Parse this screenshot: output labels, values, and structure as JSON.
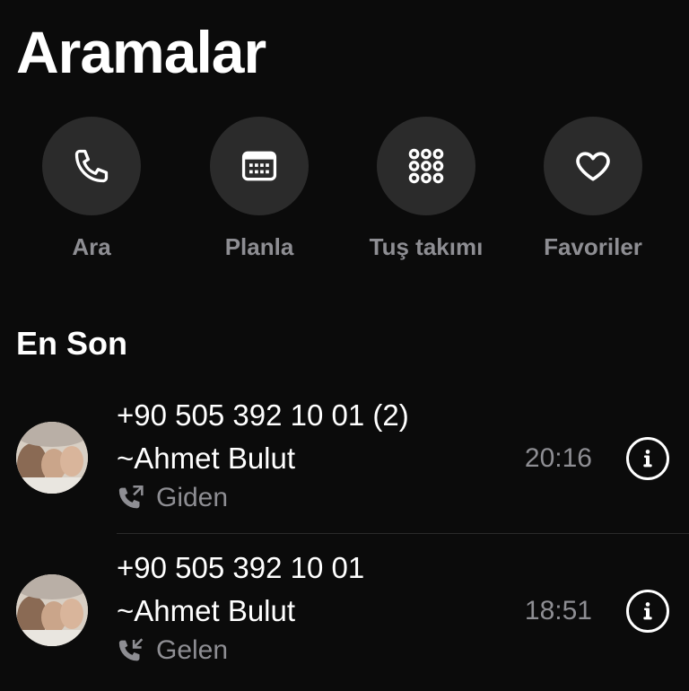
{
  "header": {
    "title": "Aramalar"
  },
  "actions": [
    {
      "label": "Ara",
      "icon": "phone-icon"
    },
    {
      "label": "Planla",
      "icon": "calendar-icon"
    },
    {
      "label": "Tuş takımı",
      "icon": "keypad-icon"
    },
    {
      "label": "Favoriler",
      "icon": "heart-icon"
    }
  ],
  "recents": {
    "title": "En Son",
    "items": [
      {
        "number": "+90 505 392 10 01  (2)",
        "name": "~Ahmet Bulut",
        "type": "Giden",
        "time": "20:16"
      },
      {
        "number": "+90 505 392 10 01",
        "name": "~Ahmet Bulut",
        "type": "Gelen",
        "time": "18:51"
      }
    ]
  },
  "colors": {
    "background": "#0b0b0b",
    "button": "#2b2b2b",
    "secondary_text": "#8e8e93"
  }
}
